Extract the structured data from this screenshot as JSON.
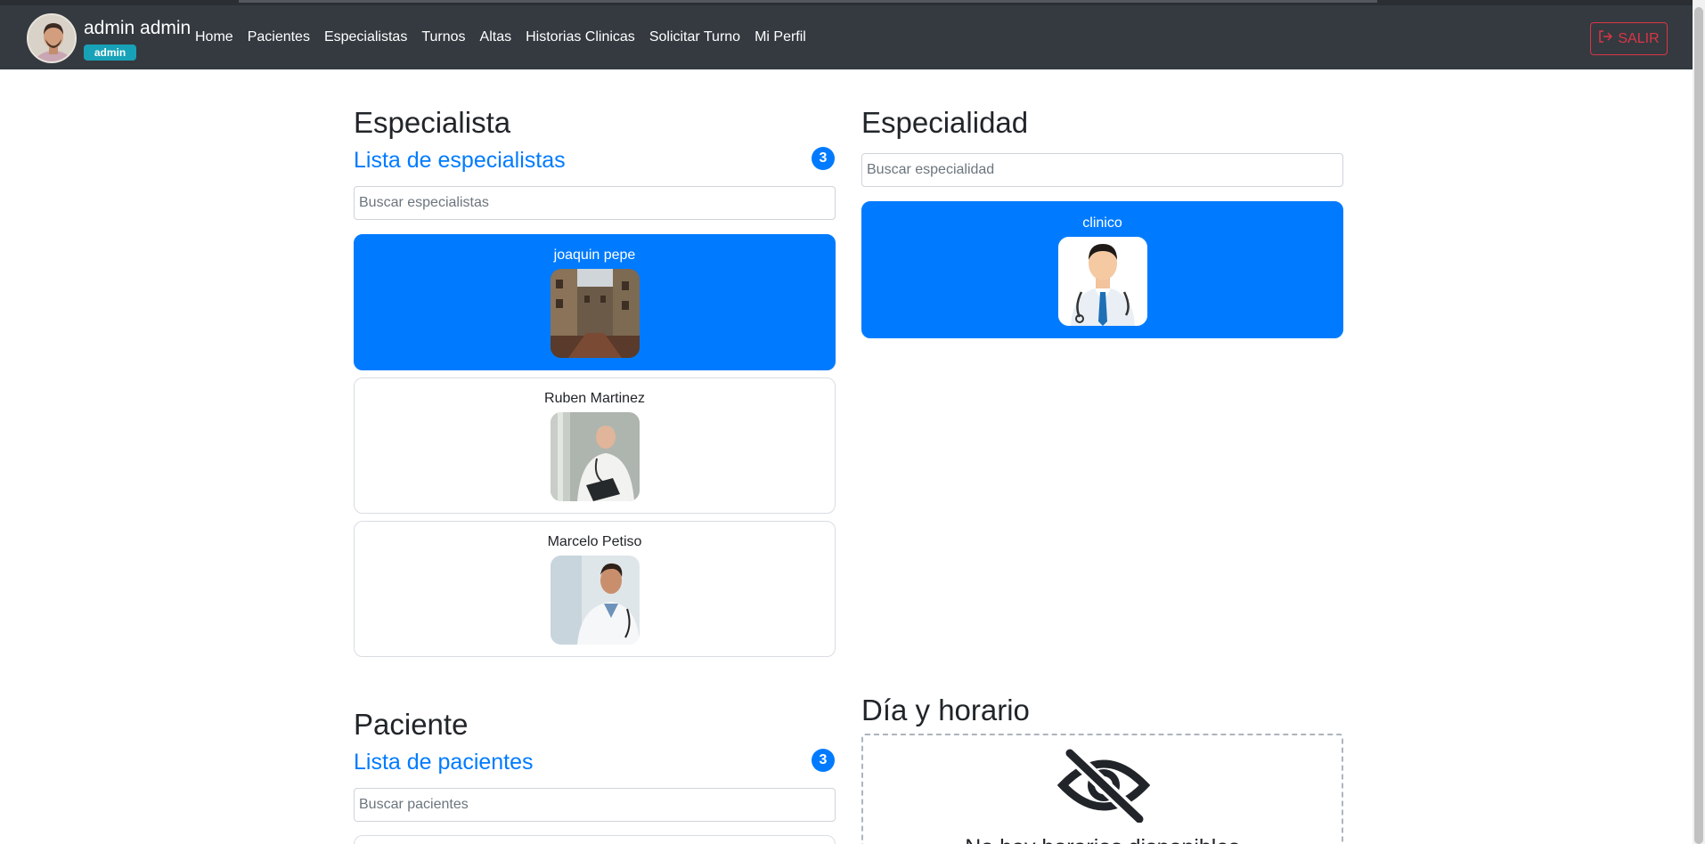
{
  "navbar": {
    "user_name": "admin admin",
    "role": "admin",
    "links": [
      "Home",
      "Pacientes",
      "Especialistas",
      "Turnos",
      "Altas",
      "Historias Clinicas",
      "Solicitar Turno",
      "Mi Perfil"
    ],
    "logout_label": "SALIR"
  },
  "specialist_section": {
    "title": "Especialista",
    "list_title": "Lista de especialistas",
    "count": "3",
    "search_placeholder": "Buscar especialistas",
    "cards": [
      {
        "name": "joaquin pepe",
        "active": true
      },
      {
        "name": "Ruben Martinez",
        "active": false
      },
      {
        "name": "Marcelo Petiso",
        "active": false
      }
    ]
  },
  "specialty_section": {
    "title": "Especialidad",
    "search_placeholder": "Buscar especialidad",
    "cards": [
      {
        "name": "clinico",
        "active": true
      }
    ]
  },
  "patient_section": {
    "title": "Paciente",
    "list_title": "Lista de pacientes",
    "count": "3",
    "search_placeholder": "Buscar pacientes"
  },
  "schedule_section": {
    "title": "Día y horario",
    "empty_message": "No hay horarios disponibles"
  },
  "colors": {
    "primary": "#007bff",
    "navbar": "#343a40",
    "danger": "#dc3545",
    "info": "#17a2b8"
  }
}
